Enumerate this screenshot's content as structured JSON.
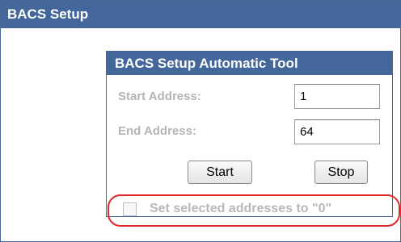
{
  "window": {
    "title": "BACS Setup"
  },
  "tool": {
    "title": "BACS Setup Automatic Tool",
    "start_address": {
      "label": "Start Address:",
      "value": "1"
    },
    "end_address": {
      "label": "End Address:",
      "value": "64"
    },
    "start_button": "Start",
    "stop_button": "Stop",
    "set_zero_checkbox": {
      "label": "Set selected addresses to \"0\"",
      "checked": false,
      "enabled": false
    }
  },
  "colors": {
    "title_bar": "#43679b",
    "disabled_text": "#b4b4b4",
    "highlight": "#e0272a"
  }
}
